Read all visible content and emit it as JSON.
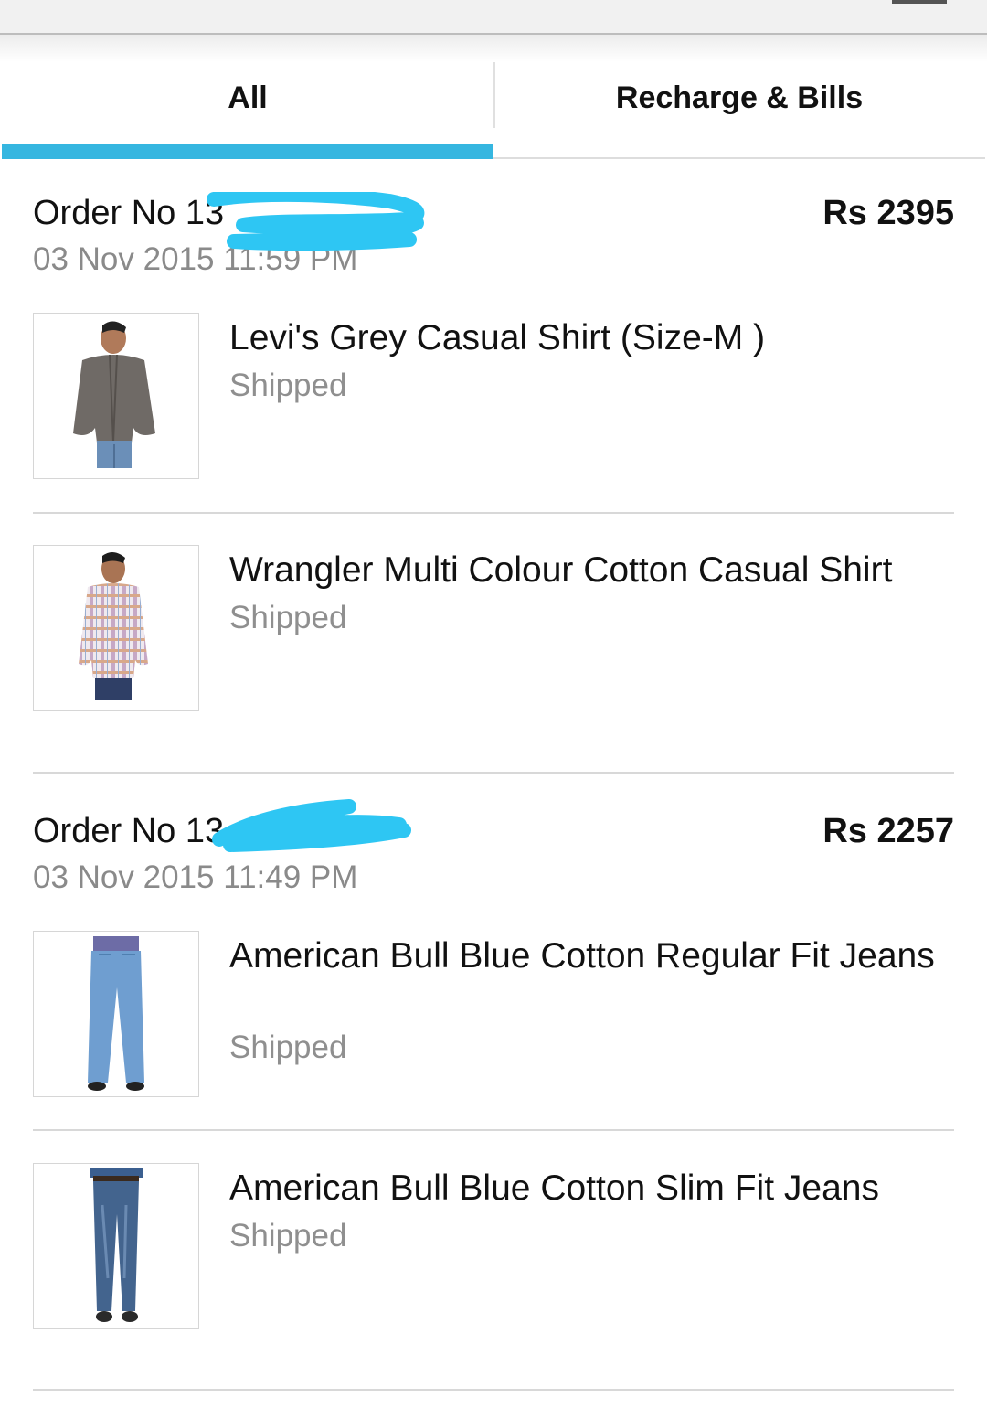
{
  "tabs": [
    {
      "label": "All",
      "active": true
    },
    {
      "label": "Recharge & Bills",
      "active": false
    }
  ],
  "accent_color": "#35b6e0",
  "redaction_color": "#2ec6f3",
  "orders": [
    {
      "order_no": "Order No 13",
      "amount": "Rs 2395",
      "date": "03 Nov 2015 11:59 PM",
      "items": [
        {
          "title": "Levi's Grey Casual Shirt (Size-M )",
          "status": "Shipped",
          "icon": "grey-shirt-model-photo"
        },
        {
          "title": "Wrangler Multi Colour Cotton Casual Shirt",
          "status": "Shipped",
          "icon": "checked-shirt-model-photo"
        }
      ]
    },
    {
      "order_no": "Order No 13",
      "amount": "Rs 2257",
      "date": "03 Nov 2015 11:49 PM",
      "items": [
        {
          "title": "American Bull Blue Cotton Regular Fit Jeans",
          "status": "Shipped",
          "icon": "regular-fit-jeans-photo"
        },
        {
          "title": "American Bull Blue Cotton Slim Fit Jeans",
          "status": "Shipped",
          "icon": "slim-fit-jeans-photo"
        }
      ]
    }
  ]
}
